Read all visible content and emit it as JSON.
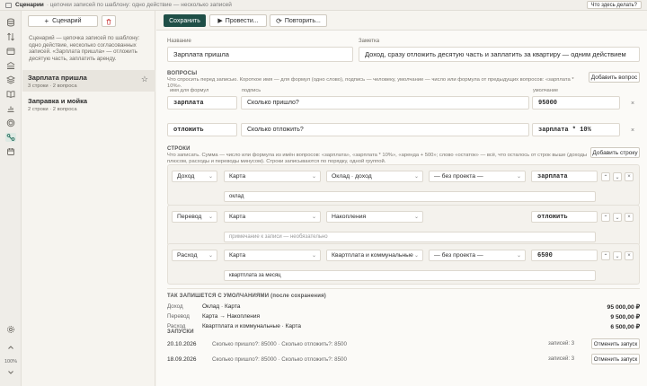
{
  "window": {
    "app": "Сценарии",
    "subtitle": "· цепочки записей по шаблону: одно действие — несколько записей",
    "help": "Что здесь делать?"
  },
  "sidebar": {
    "add_label": "Сценарий",
    "description": "Сценарий — цепочка записей по шаблону: одно действие, несколько согласованных записей. «Зарплата пришла» — отложить десятую часть, заплатить аренду.",
    "items": [
      {
        "name": "Зарплата пришла",
        "meta": "3 строки · 2 вопроса"
      },
      {
        "name": "Заправка и мойка",
        "meta": "2 строки · 2 вопроса"
      }
    ]
  },
  "rail": {
    "zoom": "100%"
  },
  "toolbar": {
    "save": "Сохранить",
    "run": "Провести...",
    "repeat": "Повторить..."
  },
  "form": {
    "name_label": "Название",
    "name_value": "Зарплата пришла",
    "note_label": "Заметка",
    "note_value": "Доход, сразу отложить десятую часть и заплатить за квартиру — одним действием"
  },
  "questions": {
    "title": "ВОПРОСЫ",
    "hint": "Что спросить перед записью. Короткое имя — для формул (одно слово), подпись — человеку, умолчание — число или формула от предыдущих вопросов: «зарплата * 10%».",
    "add": "Добавить вопрос",
    "col_name": "имя для формул",
    "col_caption": "подпись",
    "col_default": "умолчание",
    "items": [
      {
        "name": "зарплата",
        "caption": "Сколько пришло?",
        "default": "95000"
      },
      {
        "name": "отложить",
        "caption": "Сколько отложить?",
        "default": "зарплата * 10%"
      }
    ]
  },
  "rows": {
    "title": "СТРОКИ",
    "hint": "Что записать. Сумма — число или формула из имён вопросов: «зарплата», «зарплата * 10%», «аренда + 500»; слово «остаток» — всё, что осталось от строк выше (доходы плюсом, расходы и переводы минусом). Строки записываются по порядку, одной группой.",
    "add": "Добавить строку",
    "items": [
      {
        "type": "Доход",
        "account": "Карта",
        "category": "Оклад · доход",
        "project": "— без проекта —",
        "amount": "зарплата",
        "note": "оклад",
        "note_placeholder": false
      },
      {
        "type": "Перевод",
        "account": "Карта",
        "category": "Накопления",
        "project": "",
        "amount": "отложить",
        "note": "примечание к записи — необязательно",
        "note_placeholder": true
      },
      {
        "type": "Расход",
        "account": "Карта",
        "category": "Квартплата и коммунальные",
        "project": "— без проекта —",
        "amount": "6500",
        "note": "квартплата за месяц",
        "note_placeholder": false
      }
    ]
  },
  "summary": {
    "title": "ТАК ЗАПИШЕТСЯ С УМОЛЧАНИЯМИ (после сохранения)",
    "items": [
      {
        "kind": "Доход",
        "what": "Оклад · Карта",
        "amount": "95 000,00 ₽"
      },
      {
        "kind": "Перевод",
        "what": "Карта → Накопления",
        "amount": "9 500,00 ₽"
      },
      {
        "kind": "Расход",
        "what": "Квартплата и коммунальные · Карта",
        "amount": "6 500,00 ₽"
      }
    ]
  },
  "history": {
    "title": "ЗАПУСКИ",
    "items": [
      {
        "date": "20.10.2026",
        "answers": "Сколько пришло?: 85000 · Сколько отложить?: 8500",
        "count": "записей: 3",
        "cancel": "Отменить запуск"
      },
      {
        "date": "18.09.2026",
        "answers": "Сколько пришло?: 85000 · Сколько отложить?: 8500",
        "count": "записей: 3",
        "cancel": "Отменить запуск"
      }
    ]
  },
  "colors": {
    "accent": "#1f4f47",
    "active_rail": "#1f6b58",
    "delete": "#cc4444"
  },
  "icons": [
    "database-icon",
    "transfer-icon",
    "wallet-icon",
    "bank-icon",
    "layers-icon",
    "book-icon",
    "chart-icon",
    "target-icon",
    "scenario-icon",
    "calendar-icon",
    "settings-icon",
    "chevron-up-icon",
    "chevron-down-icon",
    "star-icon",
    "trash-icon",
    "play-icon",
    "repeat-icon",
    "close-icon"
  ]
}
